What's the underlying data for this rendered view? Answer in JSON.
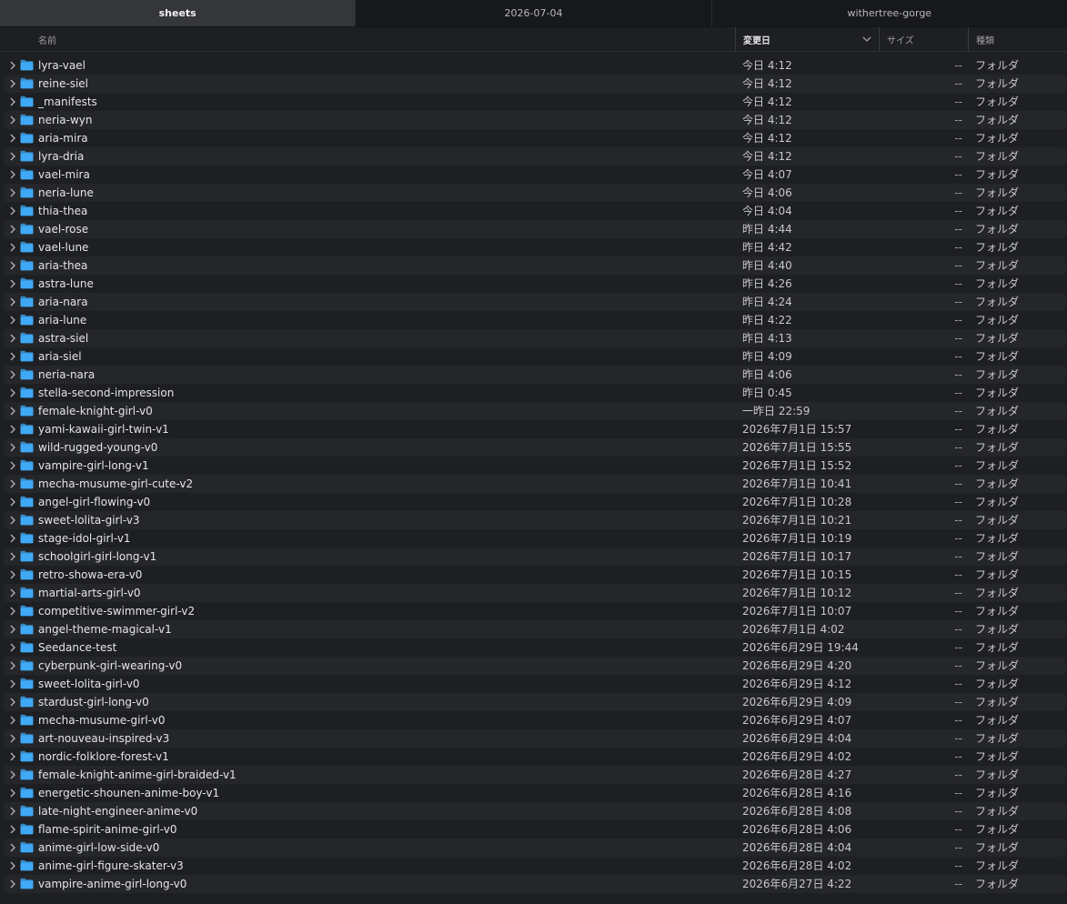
{
  "tabs": [
    {
      "label": "sheets",
      "active": true
    },
    {
      "label": "2026-07-04",
      "active": false
    },
    {
      "label": "withertree-gorge",
      "active": false
    }
  ],
  "columns": {
    "name": "名前",
    "date": "変更日",
    "size": "サイズ",
    "kind": "種類"
  },
  "folder_color": "#3fa9f5",
  "rows": [
    {
      "name": "lyra-vael",
      "date": "今日 4:12",
      "size": "--",
      "kind": "フォルダ"
    },
    {
      "name": "reine-siel",
      "date": "今日 4:12",
      "size": "--",
      "kind": "フォルダ"
    },
    {
      "name": "_manifests",
      "date": "今日 4:12",
      "size": "--",
      "kind": "フォルダ"
    },
    {
      "name": "neria-wyn",
      "date": "今日 4:12",
      "size": "--",
      "kind": "フォルダ"
    },
    {
      "name": "aria-mira",
      "date": "今日 4:12",
      "size": "--",
      "kind": "フォルダ"
    },
    {
      "name": "lyra-dria",
      "date": "今日 4:12",
      "size": "--",
      "kind": "フォルダ"
    },
    {
      "name": "vael-mira",
      "date": "今日 4:07",
      "size": "--",
      "kind": "フォルダ"
    },
    {
      "name": "neria-lune",
      "date": "今日 4:06",
      "size": "--",
      "kind": "フォルダ"
    },
    {
      "name": "thia-thea",
      "date": "今日 4:04",
      "size": "--",
      "kind": "フォルダ"
    },
    {
      "name": "vael-rose",
      "date": "昨日 4:44",
      "size": "--",
      "kind": "フォルダ"
    },
    {
      "name": "vael-lune",
      "date": "昨日 4:42",
      "size": "--",
      "kind": "フォルダ"
    },
    {
      "name": "aria-thea",
      "date": "昨日 4:40",
      "size": "--",
      "kind": "フォルダ"
    },
    {
      "name": "astra-lune",
      "date": "昨日 4:26",
      "size": "--",
      "kind": "フォルダ"
    },
    {
      "name": "aria-nara",
      "date": "昨日 4:24",
      "size": "--",
      "kind": "フォルダ"
    },
    {
      "name": "aria-lune",
      "date": "昨日 4:22",
      "size": "--",
      "kind": "フォルダ"
    },
    {
      "name": "astra-siel",
      "date": "昨日 4:13",
      "size": "--",
      "kind": "フォルダ"
    },
    {
      "name": "aria-siel",
      "date": "昨日 4:09",
      "size": "--",
      "kind": "フォルダ"
    },
    {
      "name": "neria-nara",
      "date": "昨日 4:06",
      "size": "--",
      "kind": "フォルダ"
    },
    {
      "name": "stella-second-impression",
      "date": "昨日 0:45",
      "size": "--",
      "kind": "フォルダ"
    },
    {
      "name": "female-knight-girl-v0",
      "date": "一昨日 22:59",
      "size": "--",
      "kind": "フォルダ"
    },
    {
      "name": "yami-kawaii-girl-twin-v1",
      "date": "2026年7月1日 15:57",
      "size": "--",
      "kind": "フォルダ"
    },
    {
      "name": "wild-rugged-young-v0",
      "date": "2026年7月1日 15:55",
      "size": "--",
      "kind": "フォルダ"
    },
    {
      "name": "vampire-girl-long-v1",
      "date": "2026年7月1日 15:52",
      "size": "--",
      "kind": "フォルダ"
    },
    {
      "name": "mecha-musume-girl-cute-v2",
      "date": "2026年7月1日 10:41",
      "size": "--",
      "kind": "フォルダ"
    },
    {
      "name": "angel-girl-flowing-v0",
      "date": "2026年7月1日 10:28",
      "size": "--",
      "kind": "フォルダ"
    },
    {
      "name": "sweet-lolita-girl-v3",
      "date": "2026年7月1日 10:21",
      "size": "--",
      "kind": "フォルダ"
    },
    {
      "name": "stage-idol-girl-v1",
      "date": "2026年7月1日 10:19",
      "size": "--",
      "kind": "フォルダ"
    },
    {
      "name": "schoolgirl-girl-long-v1",
      "date": "2026年7月1日 10:17",
      "size": "--",
      "kind": "フォルダ"
    },
    {
      "name": "retro-showa-era-v0",
      "date": "2026年7月1日 10:15",
      "size": "--",
      "kind": "フォルダ"
    },
    {
      "name": "martial-arts-girl-v0",
      "date": "2026年7月1日 10:12",
      "size": "--",
      "kind": "フォルダ"
    },
    {
      "name": "competitive-swimmer-girl-v2",
      "date": "2026年7月1日 10:07",
      "size": "--",
      "kind": "フォルダ"
    },
    {
      "name": "angel-theme-magical-v1",
      "date": "2026年7月1日 4:02",
      "size": "--",
      "kind": "フォルダ"
    },
    {
      "name": "Seedance-test",
      "date": "2026年6月29日 19:44",
      "size": "--",
      "kind": "フォルダ"
    },
    {
      "name": "cyberpunk-girl-wearing-v0",
      "date": "2026年6月29日 4:20",
      "size": "--",
      "kind": "フォルダ"
    },
    {
      "name": "sweet-lolita-girl-v0",
      "date": "2026年6月29日 4:12",
      "size": "--",
      "kind": "フォルダ"
    },
    {
      "name": "stardust-girl-long-v0",
      "date": "2026年6月29日 4:09",
      "size": "--",
      "kind": "フォルダ"
    },
    {
      "name": "mecha-musume-girl-v0",
      "date": "2026年6月29日 4:07",
      "size": "--",
      "kind": "フォルダ"
    },
    {
      "name": "art-nouveau-inspired-v3",
      "date": "2026年6月29日 4:04",
      "size": "--",
      "kind": "フォルダ"
    },
    {
      "name": "nordic-folklore-forest-v1",
      "date": "2026年6月29日 4:02",
      "size": "--",
      "kind": "フォルダ"
    },
    {
      "name": "female-knight-anime-girl-braided-v1",
      "date": "2026年6月28日 4:27",
      "size": "--",
      "kind": "フォルダ"
    },
    {
      "name": "energetic-shounen-anime-boy-v1",
      "date": "2026年6月28日 4:16",
      "size": "--",
      "kind": "フォルダ"
    },
    {
      "name": "late-night-engineer-anime-v0",
      "date": "2026年6月28日 4:08",
      "size": "--",
      "kind": "フォルダ"
    },
    {
      "name": "flame-spirit-anime-girl-v0",
      "date": "2026年6月28日 4:06",
      "size": "--",
      "kind": "フォルダ"
    },
    {
      "name": "anime-girl-low-side-v0",
      "date": "2026年6月28日 4:04",
      "size": "--",
      "kind": "フォルダ"
    },
    {
      "name": "anime-girl-figure-skater-v3",
      "date": "2026年6月28日 4:02",
      "size": "--",
      "kind": "フォルダ"
    },
    {
      "name": "vampire-anime-girl-long-v0",
      "date": "2026年6月27日 4:22",
      "size": "--",
      "kind": "フォルダ"
    }
  ]
}
